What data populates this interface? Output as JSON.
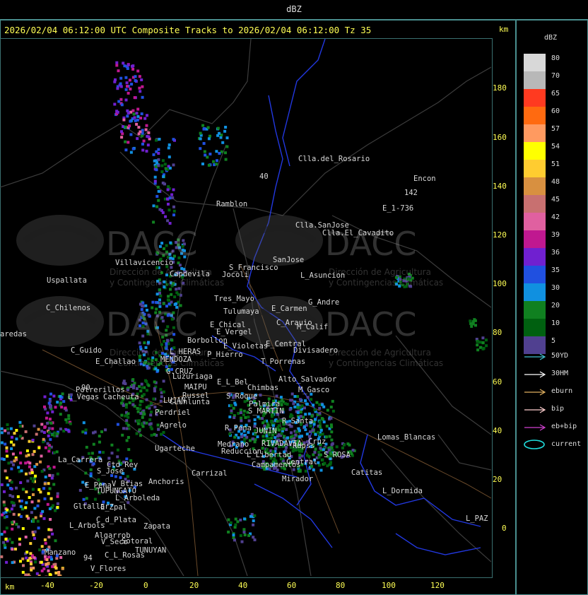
{
  "window": {
    "title": "dBZ"
  },
  "header": {
    "text": "2026/02/04 06:12:00 UTC Composite Tracks to 2026/02/04 06:12:00 Tz 35",
    "km_top": "km",
    "km_bottom": "km"
  },
  "axes": {
    "y_ticks": [
      "180",
      "160",
      "140",
      "120",
      "100",
      "80",
      "60",
      "40",
      "20",
      "0"
    ],
    "x_ticks": [
      "-40",
      "-20",
      "0",
      "20",
      "40",
      "60",
      "80",
      "100",
      "120"
    ]
  },
  "places": [
    "Clla.del_Rosario",
    "Encon",
    "142",
    "E_1-736",
    "Ramblon",
    "Clla.SanJose",
    "Clla.El_Cavadito",
    "Uspallata",
    "Villavicencio",
    "Capdevila",
    "S_Francisco",
    "SanJose",
    "L_Asuncion",
    "Jocoli",
    "Tres_Mayo",
    "C_Chilenos",
    "Tulumaya",
    "E_Carmen",
    "G_Andre",
    "E_Chical",
    "C_Arauio",
    "M_Calif",
    "aredas",
    "E_Vergel",
    "Borbollon",
    "C_Guido",
    "L_HERAS",
    "E_Violetas",
    "E_Central",
    "Divisadero",
    "P_Hierro",
    "E_Challao",
    "MENDOZA",
    "T_Porrenas",
    "G.CRUZ",
    "Luzuriaga",
    "E_L_Bel",
    "Alto_Salvador",
    "Potrerillos",
    "MAIPU",
    "Chimbas",
    "S_Roque",
    "M_Gasco",
    "L_Vegas",
    "Cacheuta",
    "LUJAN",
    "Russel",
    "CLunlunta",
    "Palmira",
    "S_MARTIN",
    "Perdriel",
    "R_Santa",
    "Agrelo",
    "R_Pena",
    "JUNIN",
    "Lomas_Blancas",
    "Ugarteche",
    "Medrano",
    "RIVADAVIA",
    "Rapss",
    "Reduccion",
    "L_Libertad",
    "Cruz",
    "La_Carrera",
    "Ctd_Rey",
    "S_Jose",
    "S_ROSA",
    "Carrizal",
    "Central",
    "Catitas",
    "Campamentos",
    "Anchoris",
    "V_Btias",
    "E_Pena",
    "TUPUNGATO",
    "Mirador",
    "L_Dormida",
    "L_Arboleda",
    "Gltallar",
    "E_Zpal",
    "L_Arbols",
    "C_d_Plata",
    "L_PAZ",
    "Zapata",
    "Algarrob",
    "V_Seco",
    "Sotoral",
    "TUNUYAN",
    "Manzano",
    "C_L_Rosas",
    "V_Flores",
    "94",
    "90",
    "40"
  ],
  "watermark": {
    "brand": "DACC",
    "line1": "Dirección de Agricultura",
    "line2": "y Contingencias Climáticas"
  },
  "legend": {
    "title": "dBZ",
    "scale": [
      {
        "label": "80",
        "color": "#d8d8d8"
      },
      {
        "label": "70",
        "color": "#b8b8b8"
      },
      {
        "label": "65",
        "color": "#ff3a20"
      },
      {
        "label": "60",
        "color": "#ff6a10"
      },
      {
        "label": "57",
        "color": "#ff9a60"
      },
      {
        "label": "54",
        "color": "#ffff00"
      },
      {
        "label": "51",
        "color": "#ffcc30"
      },
      {
        "label": "48",
        "color": "#d89040"
      },
      {
        "label": "45",
        "color": "#c87070"
      },
      {
        "label": "42",
        "color": "#e060a0"
      },
      {
        "label": "39",
        "color": "#c01890"
      },
      {
        "label": "36",
        "color": "#7020d0"
      },
      {
        "label": "35",
        "color": "#2050e0"
      },
      {
        "label": "30",
        "color": "#1090e0"
      },
      {
        "label": "20",
        "color": "#108020"
      },
      {
        "label": "10",
        "color": "#006010"
      },
      {
        "label": "5",
        "color": "#504090"
      }
    ],
    "tracks": [
      {
        "label": "50YD",
        "color": "#40c0d0"
      },
      {
        "label": "30HM",
        "color": "#ffffff"
      },
      {
        "label": "eburn",
        "color": "#e0b060"
      },
      {
        "label": "bip",
        "color": "#ffd0d0"
      },
      {
        "label": "eb+bip",
        "color": "#d040d0"
      }
    ],
    "current": {
      "label": "current",
      "color": "#20e0e0"
    }
  }
}
